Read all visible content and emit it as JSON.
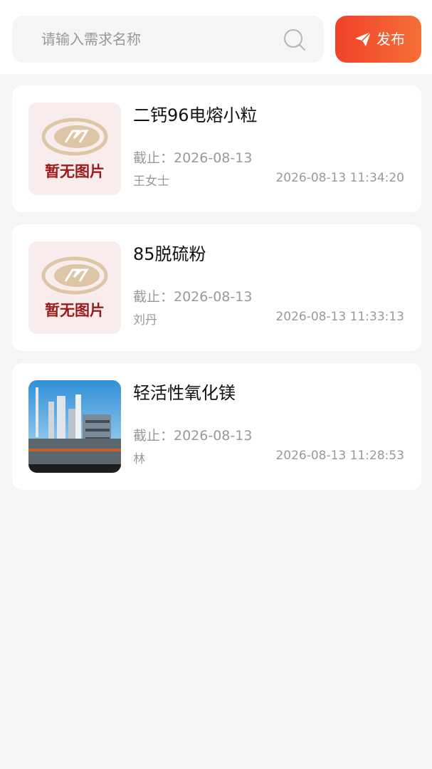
{
  "search": {
    "placeholder": "请输入需求名称"
  },
  "publish": {
    "label": "发布"
  },
  "placeholder_image": {
    "text": "暂无图片"
  },
  "items": [
    {
      "title": "二钙96电熔小粒",
      "deadline": "截止：2026-08-13",
      "person": "王女士",
      "time": "2026-08-13 11:34:20",
      "image": "placeholder"
    },
    {
      "title": "85脱硫粉",
      "deadline": "截止：2026-08-13",
      "person": "刘丹",
      "time": "2026-08-13 11:33:13",
      "image": "placeholder"
    },
    {
      "title": "轻活性氧化镁",
      "deadline": "截止：2026-08-13",
      "person": "林",
      "time": "2026-08-13 11:28:53",
      "image": "factory-photo"
    }
  ],
  "colors": {
    "accent_start": "#f0432a",
    "accent_end": "#f56e36",
    "placeholder_text": "#9b1b1b",
    "logo_tan": "#dcc6a6"
  }
}
